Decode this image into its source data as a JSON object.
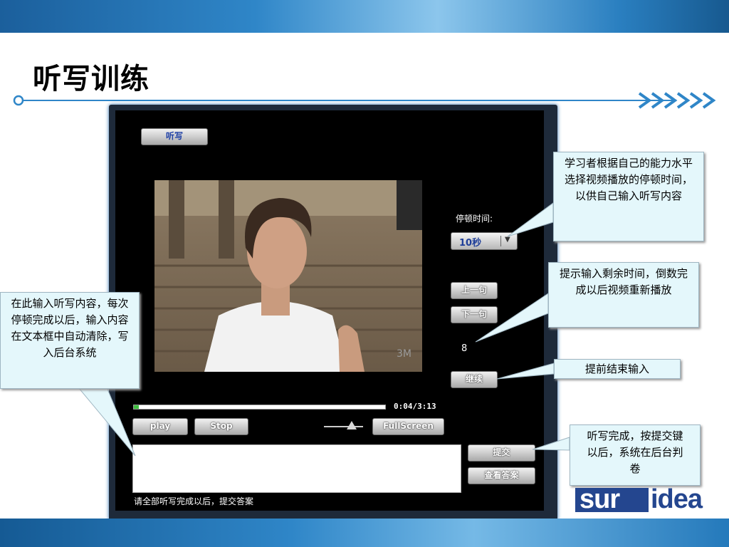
{
  "slide": {
    "title": "听写训练"
  },
  "app": {
    "tab_label": "听写",
    "pause_label": "停顿时间:",
    "pause_select": {
      "selected": "10秒"
    },
    "prev_label": "上一句",
    "next_label": "下一句",
    "countdown": "8",
    "continue_label": "继续",
    "time_display": "0:04/3:13",
    "progress_fraction": 0.021,
    "play_label": "play",
    "stop_label": "Stop",
    "fullscreen_label": "FullScreen",
    "submit_label": "提交",
    "view_answer_label": "查看答案",
    "answer_input": {
      "value": ""
    },
    "hint": "请全部听写完成以后，提交答案"
  },
  "callouts": {
    "pause_time": "学习者根据自己的能力水平选择视频播放的停顿时间，以供自己输入听写内容",
    "countdown": "提示输入剩余时间，倒数完成以后视频重新播放",
    "continue": "提前结束输入",
    "submit": "听写完成，按提交键以后，系统在后台判卷",
    "input": "在此输入听写内容，每次停顿完成以后，输入内容在文本框中自动清除，写入后台系统"
  },
  "logo": {
    "part1": "sur",
    "part2": "idea"
  },
  "colors": {
    "accent_blue": "#2f86c8",
    "callout_bg": "#e4f7fb",
    "logo_blue": "#24468f"
  }
}
